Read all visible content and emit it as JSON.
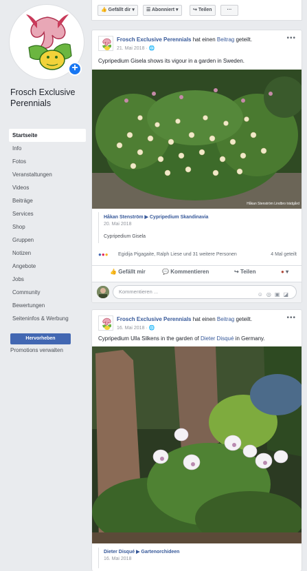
{
  "page": {
    "name": "Frosch Exclusive Perennials"
  },
  "sidebar": {
    "items": [
      {
        "label": "Startseite"
      },
      {
        "label": "Info"
      },
      {
        "label": "Fotos"
      },
      {
        "label": "Veranstaltungen"
      },
      {
        "label": "Videos"
      },
      {
        "label": "Beiträge"
      },
      {
        "label": "Services"
      },
      {
        "label": "Shop"
      },
      {
        "label": "Gruppen"
      },
      {
        "label": "Notizen"
      },
      {
        "label": "Angebote"
      },
      {
        "label": "Jobs"
      },
      {
        "label": "Community"
      },
      {
        "label": "Bewertungen"
      },
      {
        "label": "Seiteninfos & Werbung"
      }
    ],
    "cta_label": "Hervorheben",
    "promotions_label": "Promotions verwalten"
  },
  "topbar": {
    "like_label": "Gefällt dir",
    "follow_label": "Abonniert",
    "share_label": "Teilen",
    "more_label": "···"
  },
  "posts": [
    {
      "author": "Frosch Exclusive Perennials",
      "verb": "hat einen",
      "object": "Beitrag",
      "suffix": "geteilt.",
      "date": "21. Mai 2018 · ",
      "text": "Cypripedium Gisela shows its vigour in a garden in Sweden.",
      "photo_credit": "Håkan Stenström Lindbro trädgård",
      "shared_title_a": "Håkan Stenström",
      "shared_title_b": "Cypripedium Skandinavia",
      "shared_date": "20. Mai 2018",
      "shared_body": "Cypripedium Gisela",
      "reactions_text": "Egidija Pigagaite, Ralph Liese und 31 weitere Personen",
      "shares_text": "4 Mal geteilt",
      "actions": {
        "like": "Gefällt mir",
        "comment": "Kommentieren",
        "share": "Teilen"
      },
      "comment_placeholder": "Kommentieren ..."
    },
    {
      "author": "Frosch Exclusive Perennials",
      "verb": "hat einen",
      "object": "Beitrag",
      "suffix": "geteilt.",
      "date": "16. Mai 2018 · ",
      "text_a": "Cypripedium Ulla Silkens in the garden of",
      "text_link": "Dieter Disqué",
      "text_b": "in Germany.",
      "shared_title_a": "Dieter Disqué",
      "shared_title_b": "Gartenorchideen",
      "shared_date": "16. Mai 2018"
    }
  ],
  "colors": {
    "brand_blue": "#4267b2",
    "link_blue": "#365899",
    "background": "#e9ebee"
  }
}
